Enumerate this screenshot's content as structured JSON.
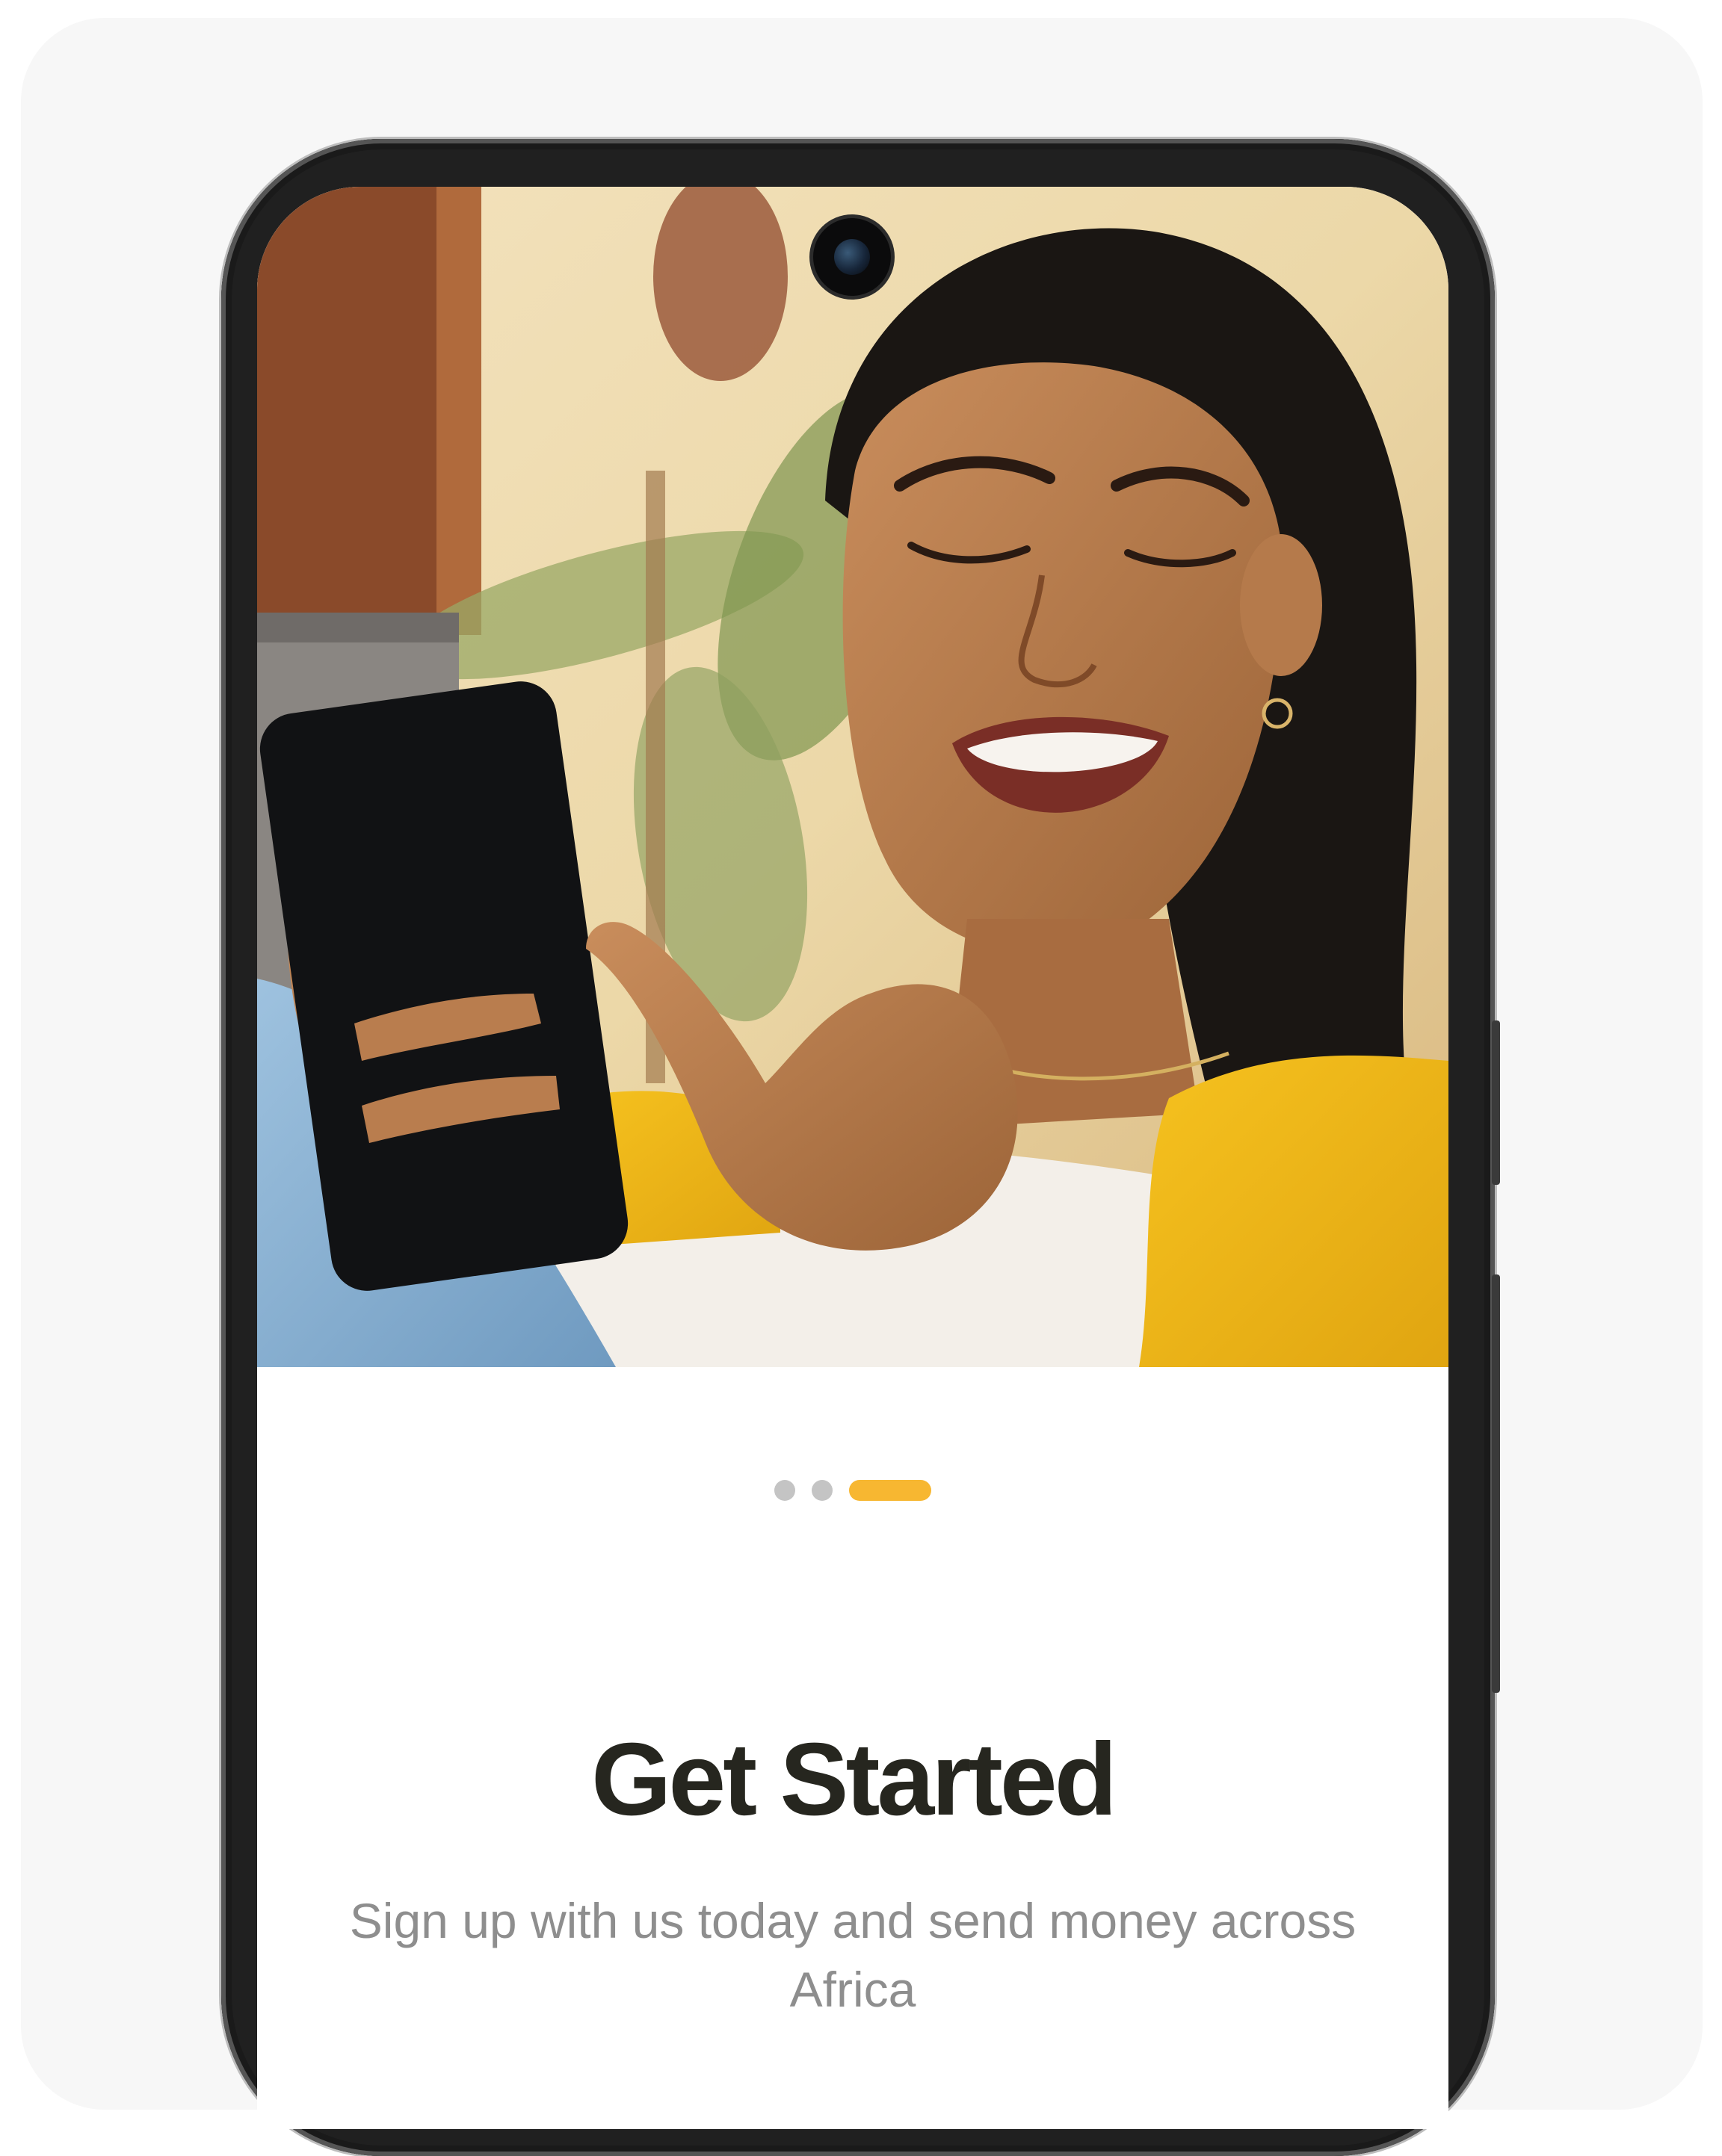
{
  "onboarding": {
    "title": "Get Started",
    "subtitle": "Sign up with us today and send money across Africa",
    "carousel": {
      "page_count": 3,
      "active_index": 2
    }
  },
  "colors": {
    "accent": "#f7b731",
    "dot_inactive": "#c4c4c4",
    "title_text": "#26261f",
    "subtitle_text": "#8e8e8e"
  }
}
